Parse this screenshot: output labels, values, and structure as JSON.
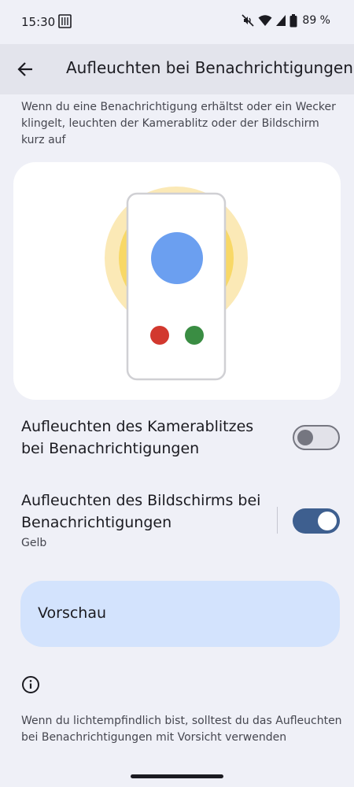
{
  "status_bar": {
    "time": "15:30",
    "battery": "89 %",
    "icons": [
      "gallery-icon",
      "mute-icon",
      "wifi-icon",
      "cell-signal-icon",
      "battery-icon"
    ]
  },
  "app_bar": {
    "title": "Aufleuchten bei Benachrichtigungen",
    "back_icon": "arrow-back-icon"
  },
  "description": "Wenn du eine Benachrichtigung erhältst oder ein Wecker klingelt, leuchten der Kamerablitz oder der Bildschirm kurz auf",
  "settings": {
    "camera_flash": {
      "title": "Aufleuchten des Kamerablitzes bei Benachrichtigungen",
      "enabled": false
    },
    "screen_flash": {
      "title": "Aufleuchten des Bildschirms bei Benachrichtigungen",
      "subtitle": "Gelb",
      "enabled": true
    }
  },
  "preview": {
    "label": "Vorschau"
  },
  "footer": {
    "info_icon": "info-icon",
    "text": "Wenn du lichtempfindlich bist, solltest du das Aufleuchten bei Benachrichtigungen mit Vorsicht verwenden"
  },
  "colors": {
    "background": "#eff0f7",
    "switch_on": "#3e5f8f",
    "preview_button": "#d3e3fd",
    "glow": "#fbe9b6",
    "blue_dot": "#6b9ff0",
    "red_dot": "#d2382e",
    "green_dot": "#3a8d43"
  }
}
